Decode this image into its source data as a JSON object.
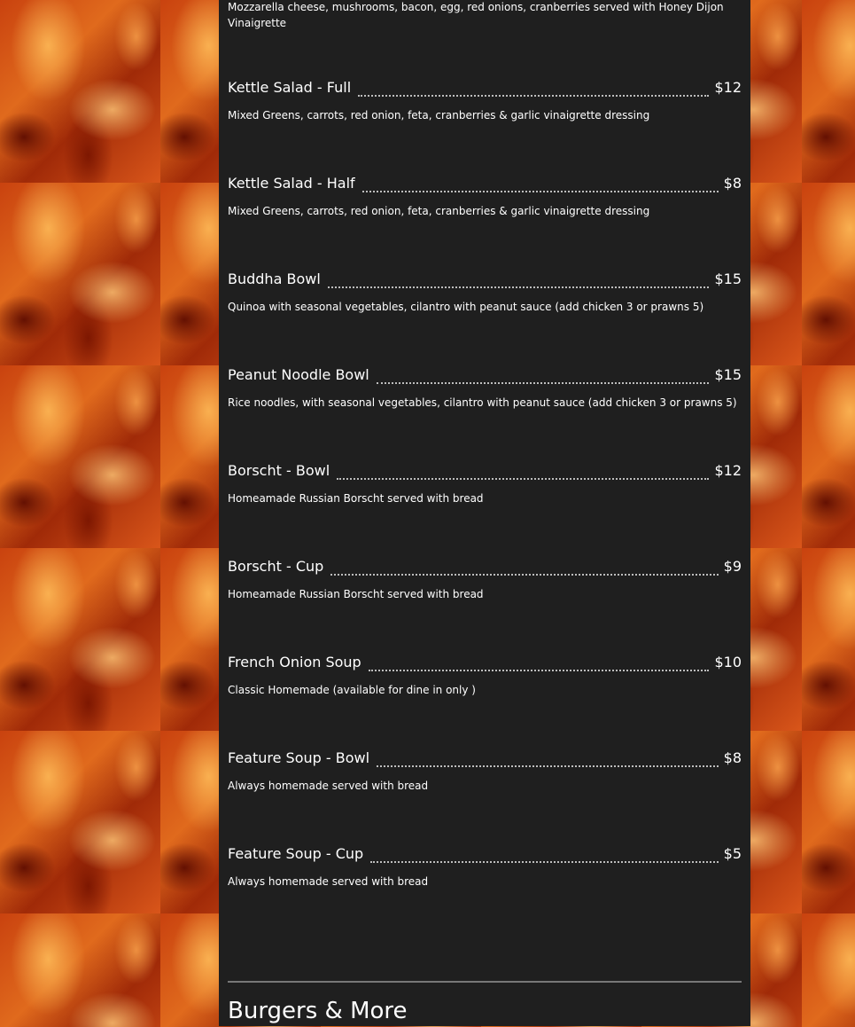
{
  "intro_text": "Mozzarella cheese, mushrooms, bacon, egg, red onions, cranberries served with Honey Dijon Vinaigrette",
  "items": [
    {
      "name": "Kettle Salad - Full",
      "price": "$12",
      "description": "Mixed Greens, carrots, red onion, feta, cranberries & garlic vinaigrette dressing"
    },
    {
      "name": "Kettle Salad - Half",
      "price": "$8",
      "description": "Mixed Greens, carrots, red onion, feta, cranberries & garlic vinaigrette dressing"
    },
    {
      "name": "Buddha Bowl",
      "price": "$15",
      "description": "Quinoa with seasonal vegetables, cilantro with peanut sauce (add chicken 3 or prawns 5)"
    },
    {
      "name": "Peanut Noodle Bowl",
      "price": "$15",
      "description": "Rice noodles, with seasonal vegetables, cilantro with peanut sauce (add chicken 3 or prawns 5)"
    },
    {
      "name": "Borscht - Bowl",
      "price": "$12",
      "description": "Homeamade Russian Borscht served with bread"
    },
    {
      "name": "Borscht - Cup",
      "price": "$9",
      "description": "Homeamade Russian Borscht served with bread"
    },
    {
      "name": "French Onion Soup",
      "price": "$10",
      "description": "Classic Homemade (available for dine in only )"
    },
    {
      "name": "Feature Soup - Bowl",
      "price": "$8",
      "description": "Always homemade served with bread"
    },
    {
      "name": "Feature Soup - Cup",
      "price": "$5",
      "description": "Always homemade served with bread"
    }
  ],
  "next_section_title": "Burgers & More"
}
